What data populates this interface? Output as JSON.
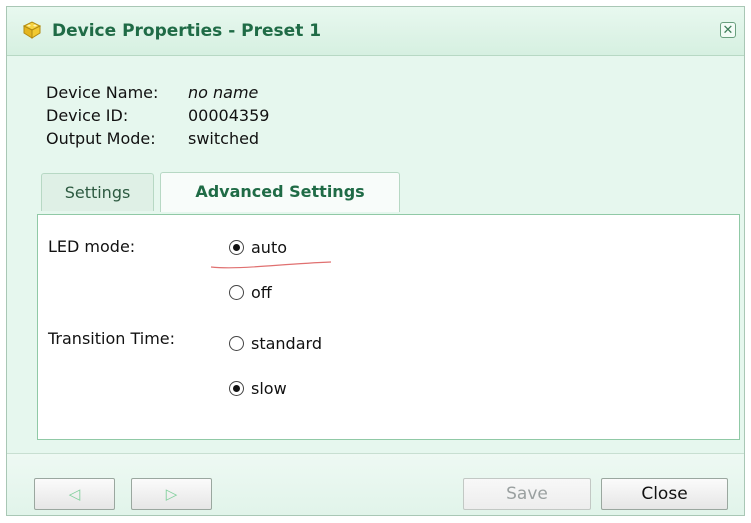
{
  "window": {
    "title": "Device Properties - Preset 1",
    "close_glyph": "✕"
  },
  "device_info": [
    {
      "label": "Device Name:",
      "value": "no name"
    },
    {
      "label": "Device ID:",
      "value": "00004359"
    },
    {
      "label": "Output Mode:",
      "value": "switched"
    }
  ],
  "tabs": [
    {
      "label": "Settings",
      "active": false
    },
    {
      "label": "Advanced Settings",
      "active": true
    }
  ],
  "advanced": {
    "led_mode": {
      "label": "LED mode:",
      "options": [
        {
          "label": "auto",
          "selected": true
        },
        {
          "label": "off",
          "selected": false
        }
      ]
    },
    "transition_time": {
      "label": "Transition Time:",
      "options": [
        {
          "label": "standard",
          "selected": false
        },
        {
          "label": "slow",
          "selected": true
        }
      ]
    }
  },
  "footer": {
    "back_glyph": "◁",
    "forward_glyph": "▷",
    "save_label": "Save",
    "close_label": "Close"
  },
  "colors": {
    "title_text": "#1f6b46",
    "window_bg": "#e6f7ee",
    "panel_border": "#90c9a6",
    "annotation_underline": "#e07070"
  }
}
